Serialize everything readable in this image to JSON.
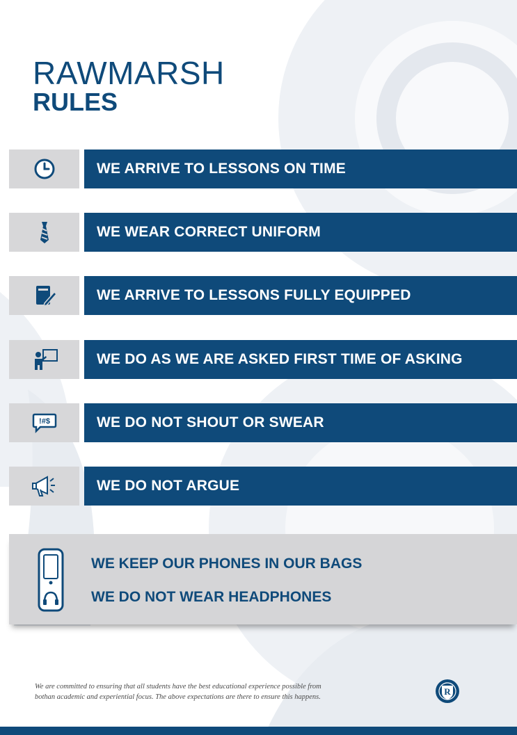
{
  "title": {
    "line1": "RAWMARSH",
    "line2": "RULES"
  },
  "rules": [
    {
      "icon": "clock-icon",
      "text": "WE ARRIVE TO LESSONS ON TIME"
    },
    {
      "icon": "tie-icon",
      "text": "WE WEAR CORRECT UNIFORM"
    },
    {
      "icon": "notebook-pencil-icon",
      "text": "WE ARRIVE TO LESSONS FULLY EQUIPPED"
    },
    {
      "icon": "teacher-board-icon",
      "text": "WE DO AS WE ARE ASKED FIRST TIME OF ASKING"
    },
    {
      "icon": "swear-speech-bubble-icon",
      "text": "WE DO NOT SHOUT OR SWEAR"
    },
    {
      "icon": "megaphone-icon",
      "text": "WE DO NOT ARGUE"
    }
  ],
  "phone_panel": {
    "icon": "phone-headphones-icon",
    "line1": "WE KEEP OUR PHONES IN OUR BAGS",
    "line2": "WE DO NOT WEAR HEADPHONES"
  },
  "swear_glyph": "!#$",
  "footer": {
    "text_line1": "We are committed to ensuring that all students have the best educational experience possible from",
    "text_line2": "bothan academic and experiential focus. The above expectations are there to ensure this happens.",
    "crest_letter": "R"
  },
  "colors": {
    "navy": "#0f4a7a",
    "icon_box": "#d7d7d9",
    "background_swirl": "#e9edf1"
  }
}
